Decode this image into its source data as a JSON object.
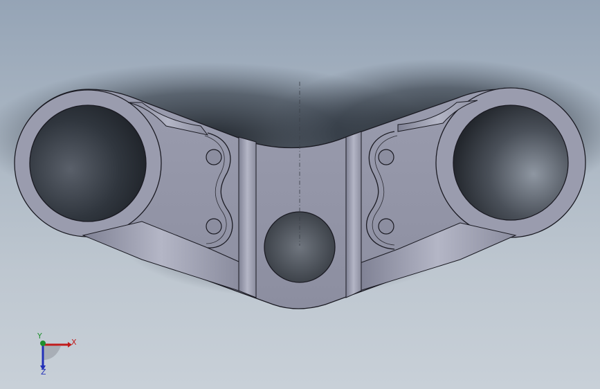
{
  "triad": {
    "x_label": "X",
    "y_label": "Y",
    "z_label": "Z"
  },
  "colors": {
    "background_top": "#95a4b6",
    "background_bottom": "#c8d0d8",
    "part_face": "#9496a8",
    "part_edge": "#1a1a22",
    "axis_x": "#c01c1c",
    "axis_y": "#1f8f2e",
    "axis_z": "#2330b8"
  }
}
